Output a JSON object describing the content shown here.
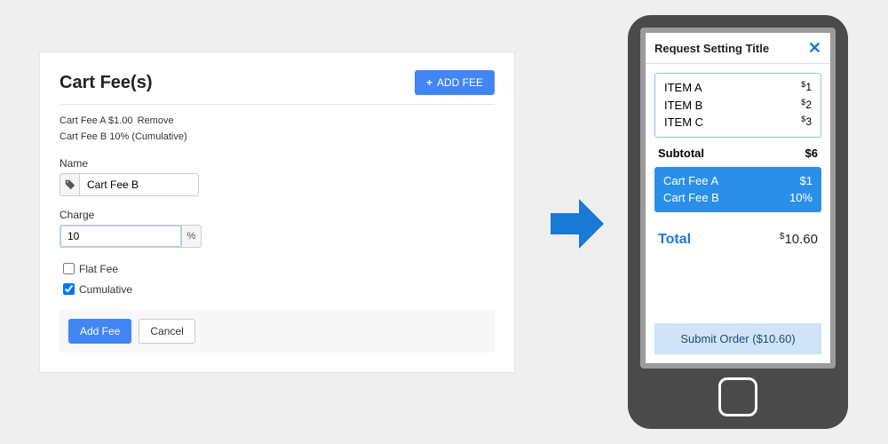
{
  "panel": {
    "title": "Cart Fee(s)",
    "add_fee_button": "ADD FEE",
    "fees": [
      {
        "text": "Cart Fee A $1.00",
        "remove": "Remove"
      },
      {
        "text": "Cart Fee B 10% (Cumulative)",
        "remove": ""
      }
    ],
    "name_label": "Name",
    "name_value": "Cart Fee B",
    "charge_label": "Charge",
    "charge_value": "10",
    "percent_symbol": "%",
    "flat_fee_label": "Flat Fee",
    "flat_fee_checked": false,
    "cumulative_label": "Cumulative",
    "cumulative_checked": true,
    "submit_label": "Add Fee",
    "cancel_label": "Cancel"
  },
  "phone": {
    "title": "Request Setting Title",
    "items": [
      {
        "name": "ITEM A",
        "price": "1"
      },
      {
        "name": "ITEM B",
        "price": "2"
      },
      {
        "name": "ITEM C",
        "price": "3"
      }
    ],
    "subtotal_label": "Subtotal",
    "subtotal_value": "6",
    "fees": [
      {
        "name": "Cart Fee A",
        "amount": "$1"
      },
      {
        "name": "Cart Fee B",
        "amount": "10%"
      }
    ],
    "total_label": "Total",
    "total_value": "10.60",
    "submit_label": "Submit Order ($10.60)"
  }
}
